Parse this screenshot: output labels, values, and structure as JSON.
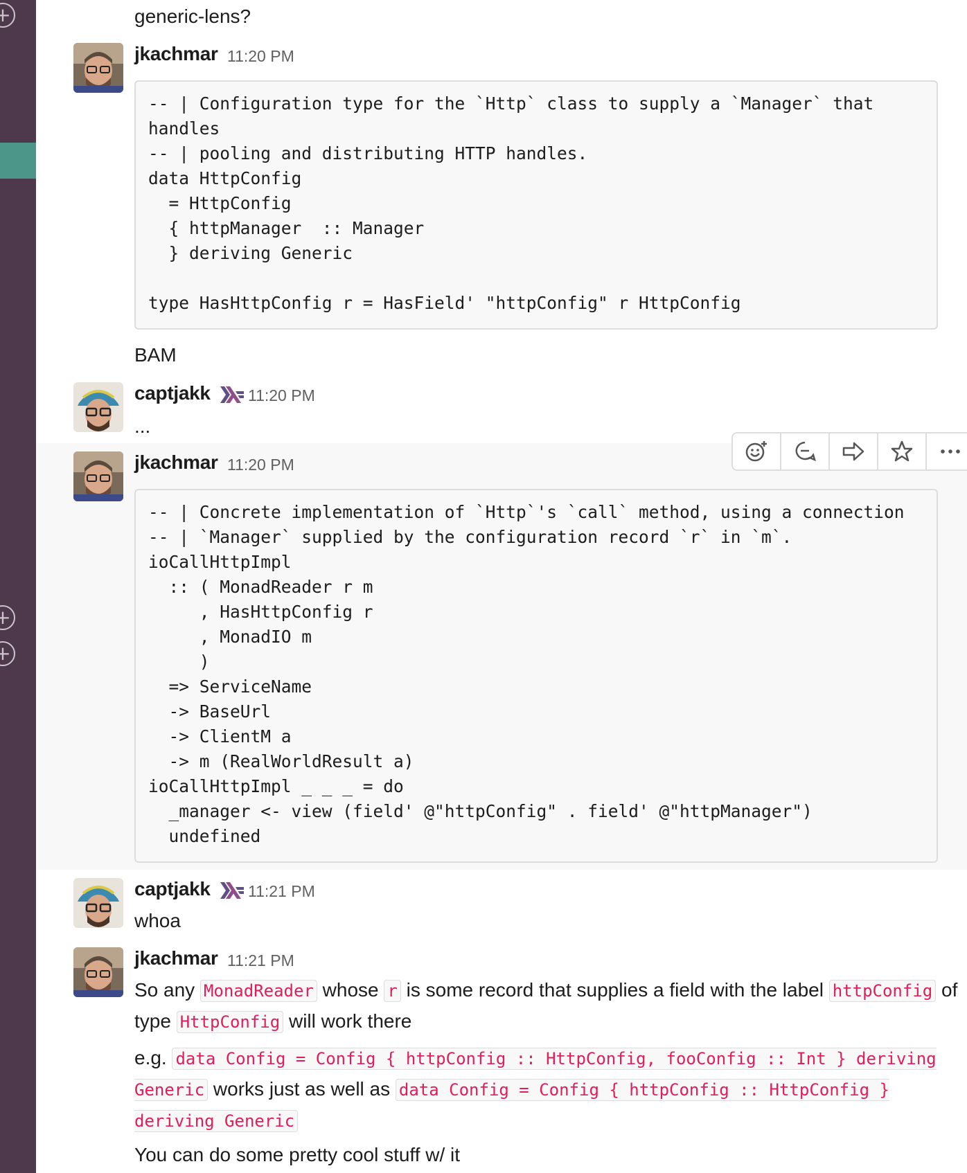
{
  "colors": {
    "sidebar": "#4d394b",
    "active": "#4c9689",
    "inline_code": "#e01e5a",
    "timestamp": "#616061"
  },
  "sidebar": {
    "icons": [
      "plus-circle-icon",
      "plus-circle-icon",
      "plus-circle-icon"
    ]
  },
  "messages": {
    "top_text": "generic-lens?",
    "m1": {
      "author": "jkachmar",
      "time": "11:20 PM",
      "code": "-- | Configuration type for the `Http` class to supply a `Manager` that\nhandles\n-- | pooling and distributing HTTP handles.\ndata HttpConfig\n  = HttpConfig\n  { httpManager  :: Manager\n  } deriving Generic\n\ntype HasHttpConfig r = HasField' \"httpConfig\" r HttpConfig",
      "after": "BAM"
    },
    "m2": {
      "author": "captjakk",
      "time": "11:20 PM",
      "text": "..."
    },
    "m3": {
      "author": "jkachmar",
      "time": "11:20 PM",
      "code": "-- | Concrete implementation of `Http`'s `call` method, using a connection\n-- | `Manager` supplied by the configuration record `r` in `m`.\nioCallHttpImpl\n  :: ( MonadReader r m\n     , HasHttpConfig r\n     , MonadIO m\n     )\n  => ServiceName\n  -> BaseUrl\n  -> ClientM a\n  -> m (RealWorldResult a)\nioCallHttpImpl _ _ _ = do\n  _manager <- view (field' @\"httpConfig\" . field' @\"httpManager\")\n  undefined"
    },
    "m4": {
      "author": "captjakk",
      "time": "11:21 PM",
      "text": "whoa"
    },
    "m5": {
      "author": "jkachmar",
      "time": "11:21 PM",
      "p1_a": "So any ",
      "p1_code1": "MonadReader",
      "p1_b": " whose ",
      "p1_code2": "r",
      "p1_c": " is some record that supplies a field with the label ",
      "p1_code3": "httpConfig",
      "p1_d": " of type ",
      "p1_code4": "HttpConfig",
      "p1_e": " will work there",
      "p2_a": "e.g. ",
      "p2_code1": "data Config = Config { httpConfig :: HttpConfig, fooConfig :: Int } deriving Generic",
      "p2_b": " works just as well as ",
      "p2_code2": "data Config = Config { httpConfig :: HttpConfig } deriving Generic",
      "p3": "You can do some pretty cool stuff w/ it"
    }
  },
  "actions": {
    "items": [
      "add-reaction-icon",
      "start-thread-icon",
      "share-message-icon",
      "save-star-icon",
      "more-actions-icon"
    ]
  }
}
